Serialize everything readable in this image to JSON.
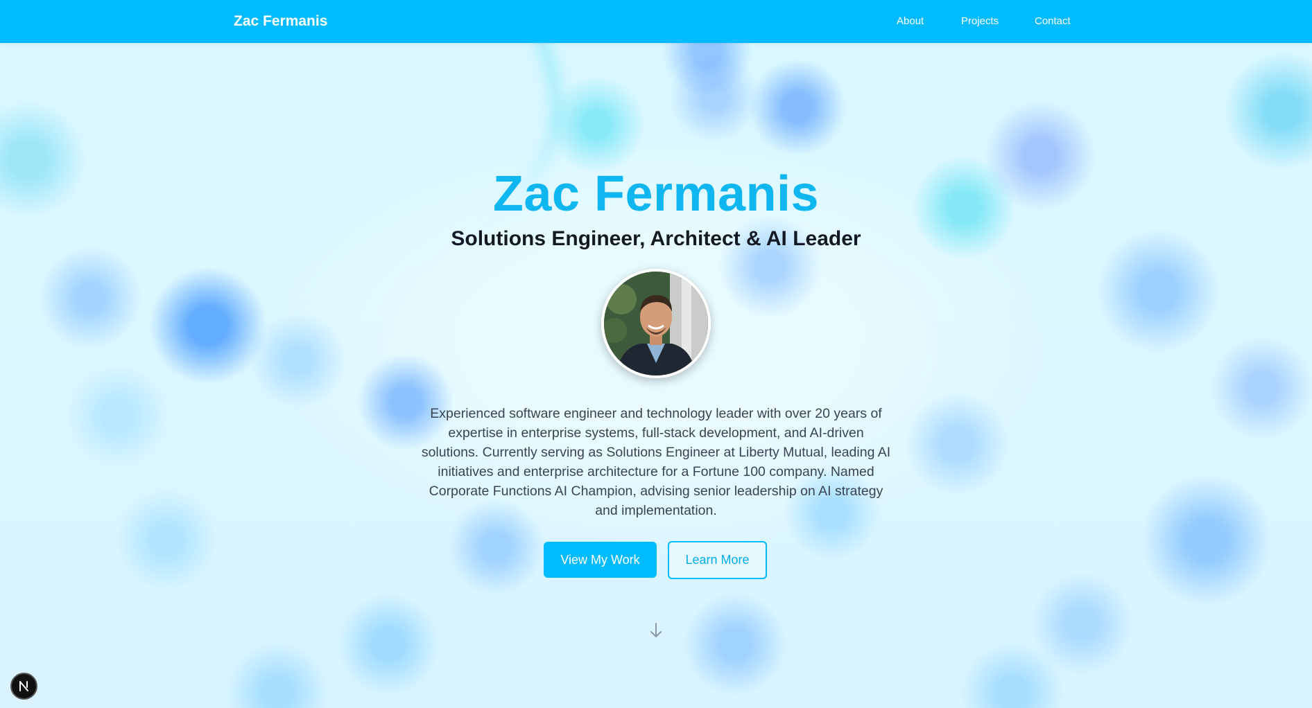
{
  "navbar": {
    "brand": "Zac Fermanis",
    "links": [
      {
        "label": "About"
      },
      {
        "label": "Projects"
      },
      {
        "label": "Contact"
      }
    ]
  },
  "hero": {
    "name": "Zac Fermanis",
    "title": "Solutions Engineer, Architect & AI Leader",
    "avatar_alt": "Portrait of Zac Fermanis",
    "bio": "Experienced software engineer and technology leader with over 20 years of expertise in enterprise systems, full-stack development, and AI-driven solutions. Currently serving as Solutions Engineer at Liberty Mutual, leading AI initiatives and enterprise architecture for a Fortune 100 company. Named Corporate Functions AI Champion, advising senior leadership on AI strategy and implementation.",
    "primary_button": "View My Work",
    "secondary_button": "Learn More",
    "scroll_icon": "arrow-down-icon"
  },
  "dev_badge": {
    "icon": "nextjs-icon",
    "letter": "N"
  },
  "colors": {
    "accent": "#00bbff",
    "heading": "#10b6ef",
    "text": "#3a4350",
    "nav_text": "#ffffff"
  }
}
